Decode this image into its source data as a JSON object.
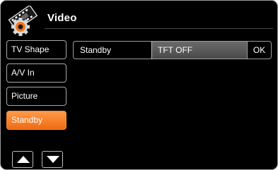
{
  "header": {
    "title": "Video",
    "icon": "film-gear-icon"
  },
  "sidebar": {
    "items": [
      {
        "label": "TV Shape",
        "active": false
      },
      {
        "label": "A/V In",
        "active": false
      },
      {
        "label": "Picture",
        "active": false
      },
      {
        "label": "Standby",
        "active": true
      }
    ],
    "scroll_up_icon": "arrow-up-icon",
    "scroll_down_icon": "arrow-down-icon"
  },
  "main": {
    "setting": {
      "label": "Standby",
      "value": "TFT OFF",
      "ok_label": "OK"
    }
  },
  "colors": {
    "background": "#000000",
    "accent": "#f07a20",
    "value_field": "#5a5a5a",
    "text": "#ffffff"
  }
}
